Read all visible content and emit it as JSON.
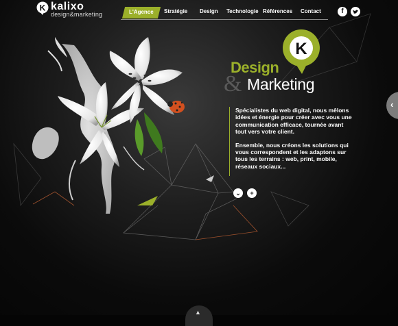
{
  "brand": {
    "name": "kalixo",
    "tagline": "design&marketing",
    "mark_letter": "K"
  },
  "nav": {
    "items": [
      {
        "label": "L'Agence",
        "active": true
      },
      {
        "label": "Stratégie"
      },
      {
        "label": "Design"
      },
      {
        "label": "Technologie"
      },
      {
        "label": "Références"
      },
      {
        "label": "Contact"
      }
    ]
  },
  "social": {
    "facebook_glyph": "f",
    "twitter_glyph": "t"
  },
  "hero": {
    "pin_letter": "K",
    "title_word1": "Design",
    "title_amp": "&",
    "title_word2": "Marketing",
    "paragraphs": [
      "Spécialistes du web digital, nous mêlons idées et énergie pour créer avec vous une communication efficace, tournée avant tout vers votre client.",
      "Ensemble, nous créons les solutions qui vous correspondent et les adaptons sur tous les terrains : web, print, mobile, réseaux sociaux..."
    ],
    "controls": {
      "down_glyph": "⌄",
      "plus_glyph": "+"
    }
  },
  "side_tab": {
    "glyph": "‹"
  },
  "bottom_tab": {
    "glyph": "▲"
  },
  "colors": {
    "accent": "#9bb02a",
    "background": "#050505",
    "text": "#ffffff"
  }
}
